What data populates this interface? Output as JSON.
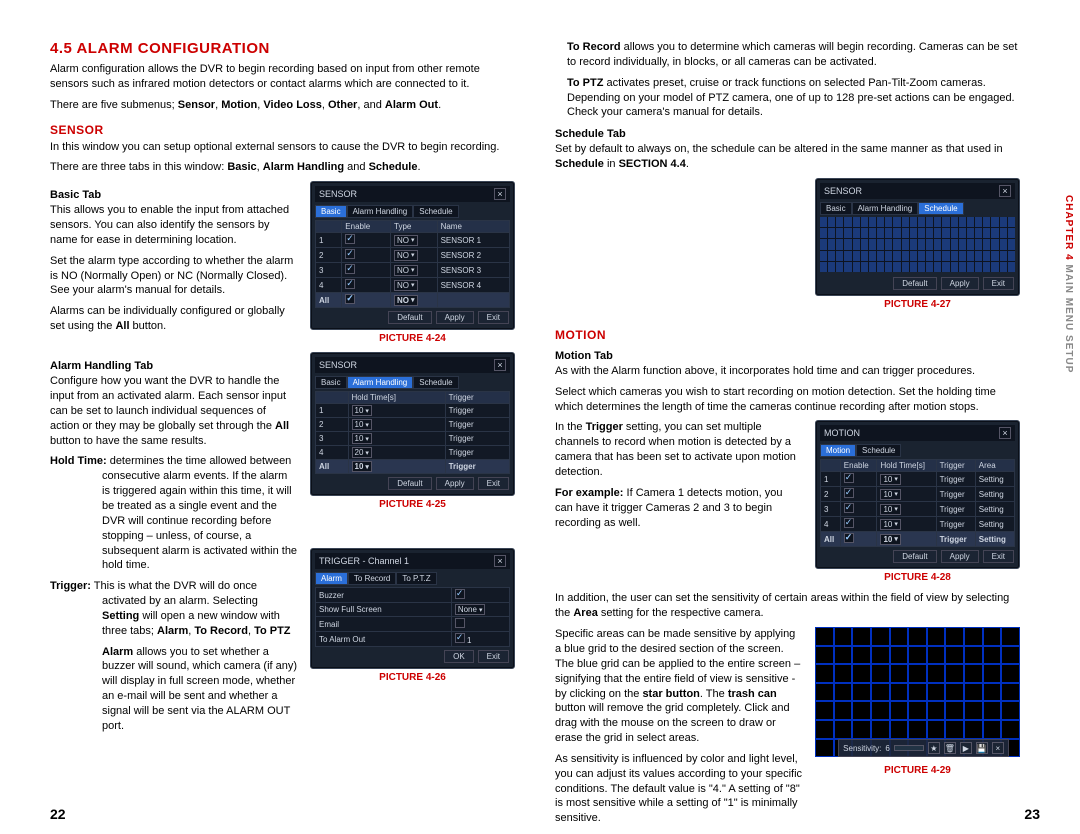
{
  "sidebar": {
    "chapter": "CHAPTER 4",
    "title": "MAIN MENU SETUP"
  },
  "pageLeft": "22",
  "pageRight": "23",
  "left": {
    "h2": "4.5 ALARM CONFIGURATION",
    "intro1": "Alarm configuration allows the DVR to begin recording based on input from other remote sensors such as infrared motion detectors or contact alarms which are connected to it.",
    "intro2a": "There are five submenus; ",
    "intro2b": "Sensor",
    "intro2c": ", ",
    "intro2d": "Motion",
    "intro2e": ", ",
    "intro2f": "Video Loss",
    "intro2g": ", ",
    "intro2h": "Other",
    "intro2i": ", and ",
    "intro2j": "Alarm Out",
    "intro2k": ".",
    "sensor": {
      "h3": "SENSOR",
      "p1": "In this window you can setup optional external sensors to cause the DVR to begin recording.",
      "p2a": "There are three tabs in this window: ",
      "p2b": "Basic",
      "p2c": ", ",
      "p2d": "Alarm Handling",
      "p2e": " and ",
      "p2f": "Schedule",
      "p2g": ".",
      "basic": {
        "h4": "Basic Tab",
        "p1": "This allows you to enable the input from attached sensors. You can also identify the sensors by name for ease in determining location.",
        "p2": "Set the alarm type according to whether the alarm is NO (Normally Open) or NC (Normally Closed). See your alarm's manual for details.",
        "p3a": "Alarms can be individually configured or globally set using the ",
        "p3b": "All",
        "p3c": " button.",
        "caption": "PICTURE 4-24"
      },
      "handling": {
        "h4": "Alarm Handling Tab",
        "p1a": "Configure how you want the DVR to handle the input from an activated alarm. Each sensor input can be set to launch individual sequences of action or they may be globally set through the ",
        "p1b": "All",
        "p1c": " button to have the same results.",
        "hold_label": "Hold Time:",
        "hold_body": " determines the time allowed between consecutive alarm events. If the alarm is triggered again within this time, it will be treated as a single event and the DVR will continue recording before stopping – unless, of course, a subsequent alarm is activated within the hold time.",
        "trig_label": "Trigger:",
        "trig_body1a": " This is what the DVR will do once activated by an alarm. Selecting ",
        "trig_body1b": "Setting",
        "trig_body1c": " will open a new window with three tabs; ",
        "trig_body1d": "Alarm",
        "trig_body1e": ", ",
        "trig_body1f": "To Record",
        "trig_body1g": ", ",
        "trig_body1h": "To PTZ",
        "trig_body2a": "Alarm",
        "trig_body2b": " allows you to set whether a buzzer will sound, which camera (if any) will display in full screen mode, whether an e-mail will be sent and whether a signal will be sent via the ALARM OUT port.",
        "caption25": "PICTURE 4-25",
        "caption26": "PICTURE 4-26"
      }
    }
  },
  "right": {
    "toRecord_label": "To Record",
    "toRecord_body": " allows you to determine which cameras will begin recording. Cameras can be set to record individually, in blocks, or all cameras can be activated.",
    "toPTZ_label": "To PTZ",
    "toPTZ_body": " activates preset, cruise or track functions on selected Pan-Tilt-Zoom cameras. Depending on your model of PTZ camera, one of up to 128 pre-set actions can be engaged. Check your camera's manual for details.",
    "sched": {
      "h4": "Schedule Tab",
      "p1a": "Set by default to always on, the schedule can be altered in the same manner as that used in ",
      "p1b": "Schedule",
      "p1c": " in ",
      "p1d": "SECTION 4.4",
      "p1e": ".",
      "caption": "PICTURE 4-27"
    },
    "motion": {
      "h3": "MOTION",
      "h4": "Motion Tab",
      "p1": "As with the Alarm function above, it incorporates hold time and can trigger procedures.",
      "p2": "Select which cameras you wish to start recording on motion detection. Set the holding time which determines the length of time the cameras continue recording after motion stops.",
      "p3a": "In the ",
      "p3b": "Trigger",
      "p3c": " setting, you can set multiple channels to record when motion is detected by a camera that has been set to activate upon motion detection.",
      "p4a": "For example:",
      "p4b": " If Camera 1 detects motion, you can have it trigger Cameras 2 and 3 to begin recording as well.",
      "caption28": "PICTURE 4-28",
      "p5a": "In addition, the user can set the sensitivity of certain areas within the field of view by selecting the ",
      "p5b": "Area",
      "p5c": " setting for the respective camera.",
      "p6a": "Specific areas can be made sensitive by applying a blue grid to the desired section of the screen. The blue grid can be applied to the entire screen – signifying that the entire field of view is sensitive - by clicking on the ",
      "p6b": "star button",
      "p6c": ". The ",
      "p6d": "trash can",
      "p6e": " button will remove the grid completely. Click and drag with the mouse on the screen to draw or erase the grid in select areas.",
      "p7": " As sensitivity is influenced by color and light level, you can adjust its values according to your specific conditions. The default value is \"4.\" A setting of \"8\" is most sensitive while a setting of \"1\" is minimally sensitive.",
      "caption29": "PICTURE 4-29",
      "sens_label": "Sensitivity:",
      "sens_val": "6"
    }
  },
  "mock": {
    "sensor_title": "SENSOR",
    "trigger_title": "TRIGGER - Channel 1",
    "motion_title": "MOTION",
    "tabs": {
      "basic": "Basic",
      "alarm": "Alarm Handling",
      "schedule": "Schedule",
      "alarmT": "Alarm",
      "toRec": "To Record",
      "toPTZ": "To P.T.Z",
      "motion": "Motion"
    },
    "cols": {
      "enable": "Enable",
      "type": "Type",
      "name": "Name",
      "hold": "Hold Time[s]",
      "trigger": "Trigger",
      "setting": "Setting",
      "area": "Area"
    },
    "vals": {
      "no": "NO",
      "s1": "SENSOR 1",
      "s2": "SENSOR 2",
      "s3": "SENSOR 3",
      "s4": "SENSOR 4",
      "t10": "10",
      "t20": "20",
      "trig": "Trigger",
      "none": "None",
      "one": "1"
    },
    "rows": {
      "r1": "1",
      "r2": "2",
      "r3": "3",
      "r4": "4",
      "all": "All"
    },
    "trigrows": {
      "buzzer": "Buzzer",
      "full": "Show Full Screen",
      "email": "Email",
      "out": "To Alarm Out"
    },
    "btn": {
      "default": "Default",
      "apply": "Apply",
      "exit": "Exit",
      "ok": "OK"
    }
  }
}
